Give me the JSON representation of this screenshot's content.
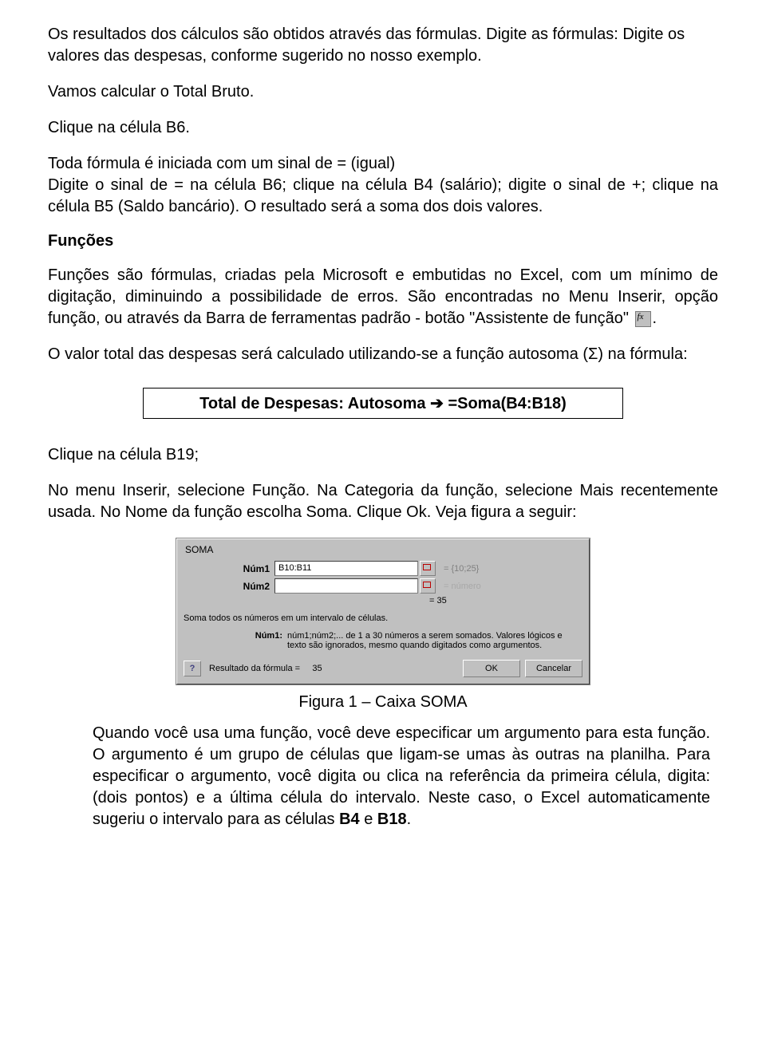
{
  "p1": "Os resultados dos cálculos são obtidos através das fórmulas. Digite as fórmulas: Digite os valores das despesas, conforme sugerido no nosso exemplo.",
  "p2": "Vamos calcular o Total Bruto.",
  "p3": "Clique na célula B6.",
  "p4": "Toda fórmula é iniciada com um sinal de = (igual)",
  "p5": "Digite o sinal de = na célula B6; clique na célula B4 (salário); digite o sinal de +; clique na célula B5 (Saldo bancário). O resultado será a soma dos dois valores.",
  "h1": "Funções",
  "p6a": "Funções são fórmulas, criadas pela Microsoft e embutidas no Excel, com um mínimo de digitação, diminuindo a possibilidade de erros. São encontradas no Menu Inserir, opção função, ou através da Barra de ferramentas padrão - botão \"Assistente de função\" ",
  "p6b": ".",
  "p7": "O valor total das despesas será calculado utilizando-se a função autosoma (Σ) na fórmula:",
  "formula_label": "Total de Despesas: Autosoma ",
  "formula_arrow": "➔",
  "formula_expr": " =Soma(B4:B18)",
  "p8": "Clique na célula B19;",
  "p9": "No menu Inserir, selecione Função. Na Categoria da função, selecione Mais recentemente usada. No Nome da função escolha Soma. Clique Ok. Veja figura a seguir:",
  "dialog": {
    "title": "SOMA",
    "num1_label": "Núm1",
    "num1_value": "B10:B11",
    "num1_result": "= {10;25}",
    "num2_label": "Núm2",
    "num2_value": "",
    "num2_result": "= número",
    "calc_result": "= 35",
    "desc": "Soma todos os números em um intervalo de células.",
    "arg_label": "Núm1:",
    "arg_desc": "núm1;núm2;... de 1 a 30 números a serem somados. Valores lógicos e texto são ignorados, mesmo quando digitados como argumentos.",
    "help": "?",
    "result_prefix": "Resultado da fórmula =",
    "result_value": "35",
    "ok": "OK",
    "cancel": "Cancelar"
  },
  "fig_caption": "Figura 1 – Caixa SOMA",
  "p10a": "Quando você usa uma função, você deve especificar um argumento para esta função. O argumento é um grupo de células que ligam-se umas às outras na planilha. Para especificar o argumento, você digita ou clica na referência da primeira célula, digita: (dois pontos) e a última célula do intervalo. Neste caso, o Excel automaticamente sugeriu o intervalo para as células ",
  "p10b1": "B4",
  "p10c": " e ",
  "p10b2": "B18",
  "p10d": "."
}
